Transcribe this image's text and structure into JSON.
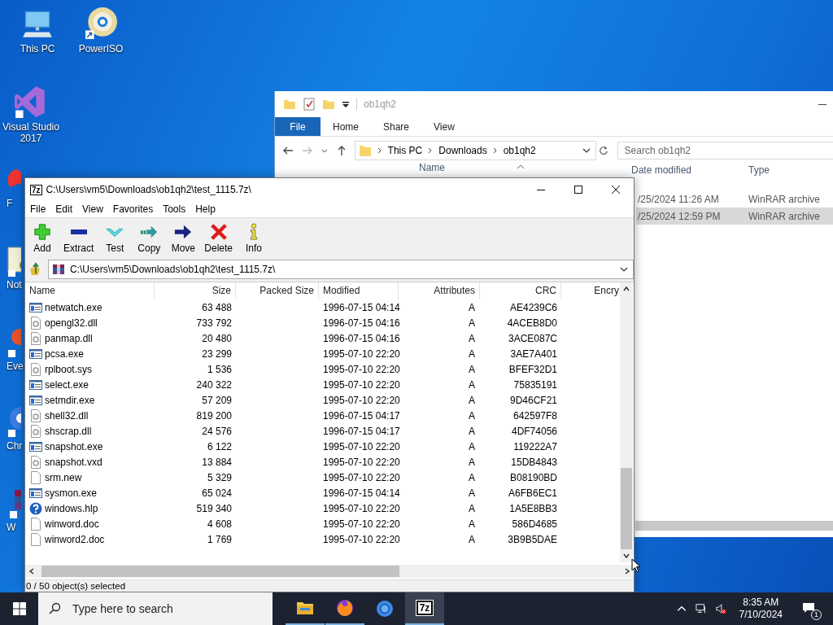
{
  "desktop_icons": [
    {
      "label": "This PC",
      "kind": "pc"
    },
    {
      "label": "PowerISO",
      "kind": "disc"
    },
    {
      "label": "Visual Studio 2017",
      "kind": "vs"
    },
    {
      "label": "F",
      "kind": "fox"
    },
    {
      "label": "Not",
      "kind": "notepad"
    },
    {
      "label": "Eve",
      "kind": "eve"
    },
    {
      "label": "Chr",
      "kind": "chrome"
    },
    {
      "label": "W",
      "kind": "winrar"
    }
  ],
  "explorer": {
    "title": "ob1qh2",
    "ribbon_tabs": [
      {
        "label": "File",
        "kind": "menu"
      },
      {
        "label": "Home",
        "kind": "tab"
      },
      {
        "label": "Share",
        "kind": "tab"
      },
      {
        "label": "View",
        "kind": "tab"
      }
    ],
    "breadcrumb": [
      "This PC",
      "Downloads",
      "ob1qh2"
    ],
    "search": {
      "placeholder": "Search ob1qh2"
    },
    "columns": [
      "Name",
      "Date modified",
      "Type"
    ],
    "rows": [
      {
        "date_modified": "/25/2024 11:26 AM",
        "type": "WinRAR archive",
        "selected": false
      },
      {
        "date_modified": "/25/2024 12:59 PM",
        "type": "WinRAR archive",
        "selected": true
      }
    ]
  },
  "archiver": {
    "icon_text": "7z",
    "title": "C:\\Users\\vm5\\Downloads\\ob1qh2\\test_1115.7z\\",
    "menu": [
      "File",
      "Edit",
      "View",
      "Favorites",
      "Tools",
      "Help"
    ],
    "toolbar": [
      {
        "label": "Add",
        "kind": "add"
      },
      {
        "label": "Extract",
        "kind": "extract"
      },
      {
        "label": "Test",
        "kind": "test"
      },
      {
        "label": "Copy",
        "kind": "copy"
      },
      {
        "label": "Move",
        "kind": "move"
      },
      {
        "label": "Delete",
        "kind": "delete"
      },
      {
        "label": "Info",
        "kind": "info"
      }
    ],
    "path": "C:\\Users\\vm5\\Downloads\\ob1qh2\\test_1115.7z\\",
    "columns": [
      "Name",
      "Size",
      "Packed Size",
      "Modified",
      "Attributes",
      "CRC",
      "Encry"
    ],
    "files": [
      {
        "name": "netwatch.exe",
        "kind": "exe",
        "size": "63 488",
        "modified": "1996-07-15 04:14",
        "attributes": "A",
        "crc": "AE4239C6"
      },
      {
        "name": "opengl32.dll",
        "kind": "dll",
        "size": "733 792",
        "modified": "1996-07-15 04:16",
        "attributes": "A",
        "crc": "4ACEB8D0"
      },
      {
        "name": "panmap.dll",
        "kind": "dll",
        "size": "20 480",
        "modified": "1996-07-15 04:16",
        "attributes": "A",
        "crc": "3ACE087C"
      },
      {
        "name": "pcsa.exe",
        "kind": "exe",
        "size": "23 299",
        "modified": "1995-07-10 22:20",
        "attributes": "A",
        "crc": "3AE7A401"
      },
      {
        "name": "rplboot.sys",
        "kind": "dll",
        "size": "1 536",
        "modified": "1995-07-10 22:20",
        "attributes": "A",
        "crc": "BFEF32D1"
      },
      {
        "name": "select.exe",
        "kind": "exe",
        "size": "240 322",
        "modified": "1995-07-10 22:20",
        "attributes": "A",
        "crc": "75835191"
      },
      {
        "name": "setmdir.exe",
        "kind": "exe",
        "size": "57 209",
        "modified": "1995-07-10 22:20",
        "attributes": "A",
        "crc": "9D46CF21"
      },
      {
        "name": "shell32.dll",
        "kind": "dll",
        "size": "819 200",
        "modified": "1996-07-15 04:17",
        "attributes": "A",
        "crc": "642597F8"
      },
      {
        "name": "shscrap.dll",
        "kind": "dll",
        "size": "24 576",
        "modified": "1996-07-15 04:17",
        "attributes": "A",
        "crc": "4DF74056"
      },
      {
        "name": "snapshot.exe",
        "kind": "exe",
        "size": "6 122",
        "modified": "1995-07-10 22:20",
        "attributes": "A",
        "crc": "119222A7"
      },
      {
        "name": "snapshot.vxd",
        "kind": "dll",
        "size": "13 884",
        "modified": "1995-07-10 22:20",
        "attributes": "A",
        "crc": "15DB4843"
      },
      {
        "name": "srm.new",
        "kind": "plain",
        "size": "5 329",
        "modified": "1995-07-10 22:20",
        "attributes": "A",
        "crc": "B08190BD"
      },
      {
        "name": "sysmon.exe",
        "kind": "exe",
        "size": "65 024",
        "modified": "1996-07-15 04:14",
        "attributes": "A",
        "crc": "A6FB6EC1"
      },
      {
        "name": "windows.hlp",
        "kind": "help",
        "size": "519 340",
        "modified": "1995-07-10 22:20",
        "attributes": "A",
        "crc": "1A5E8BB3"
      },
      {
        "name": "winword.doc",
        "kind": "plain",
        "size": "4 608",
        "modified": "1995-07-10 22:20",
        "attributes": "A",
        "crc": "586D4685"
      },
      {
        "name": "winword2.doc",
        "kind": "plain",
        "size": "1 769",
        "modified": "1995-07-10 22:20",
        "attributes": "A",
        "crc": "3B9B5DAE"
      }
    ],
    "status": "0 / 50 object(s) selected"
  },
  "taskbar": {
    "search": {
      "placeholder": "Type here to search"
    },
    "apps": [
      {
        "kind": "explorer",
        "running": true,
        "selected": false
      },
      {
        "kind": "firefox",
        "running": true,
        "selected": false
      },
      {
        "kind": "chrome",
        "running": false,
        "selected": false
      },
      {
        "kind": "archiver",
        "running": true,
        "selected": true,
        "icon_text": "7z"
      }
    ],
    "time": "8:35 AM",
    "date": "7/10/2024",
    "notification_count": "1"
  }
}
